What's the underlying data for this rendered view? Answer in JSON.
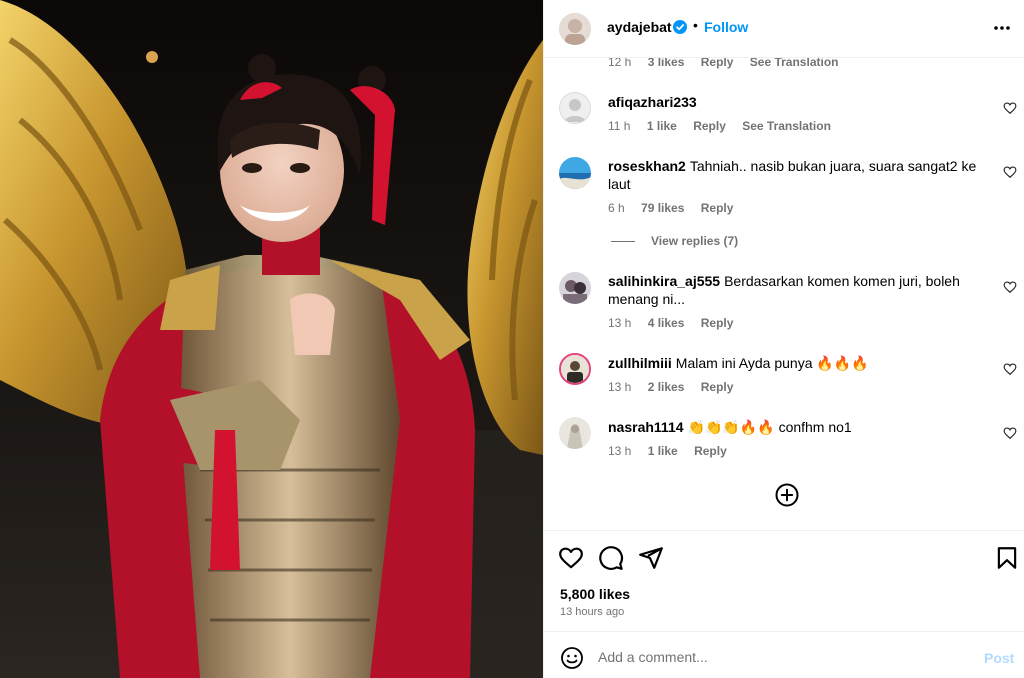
{
  "header": {
    "username": "aydajebat",
    "separator": "•",
    "follow_label": "Follow",
    "more_icon": "more-horizontal-icon",
    "verified_icon": "verified-badge-icon"
  },
  "top_partial_meta": {
    "time": "12 h",
    "likes": "3 likes",
    "reply": "Reply",
    "translate": "See Translation"
  },
  "comments": [
    {
      "user": "afiqazhari233",
      "text": "",
      "time": "11 h",
      "likes": "1 like",
      "reply": "Reply",
      "translate": "See Translation"
    },
    {
      "user": "roseskhan2",
      "text": "Tahniah.. nasib bukan juara, suara sangat2 ke laut",
      "time": "6 h",
      "likes": "79 likes",
      "reply": "Reply",
      "translate": ""
    },
    {
      "user": "salihinkira_aj555",
      "text": "Berdasarkan komen komen juri, boleh menang ni...",
      "time": "13 h",
      "likes": "4 likes",
      "reply": "Reply",
      "translate": ""
    },
    {
      "user": "zullhilmiii",
      "text": "Malam ini Ayda punya 🔥🔥🔥",
      "time": "13 h",
      "likes": "2 likes",
      "reply": "Reply",
      "translate": ""
    },
    {
      "user": "nasrah1114",
      "text": "👏👏👏🔥🔥 confhm no1",
      "time": "13 h",
      "likes": "1 like",
      "reply": "Reply",
      "translate": ""
    }
  ],
  "view_replies": "View replies (7)",
  "load_more_icon": "plus-circle-icon",
  "actions": {
    "like_icon": "heart-icon",
    "comment_icon": "comment-icon",
    "share_icon": "send-icon",
    "save_icon": "bookmark-icon",
    "likes": "5,800 likes",
    "time_ago": "13 hours ago"
  },
  "add_comment": {
    "emoji_icon": "emoji-icon",
    "placeholder": "Add a comment...",
    "post_label": "Post",
    "post_color": "#b3dbff"
  },
  "colors": {
    "follow": "#0095f6",
    "muted": "#737373",
    "border": "#efefef"
  }
}
